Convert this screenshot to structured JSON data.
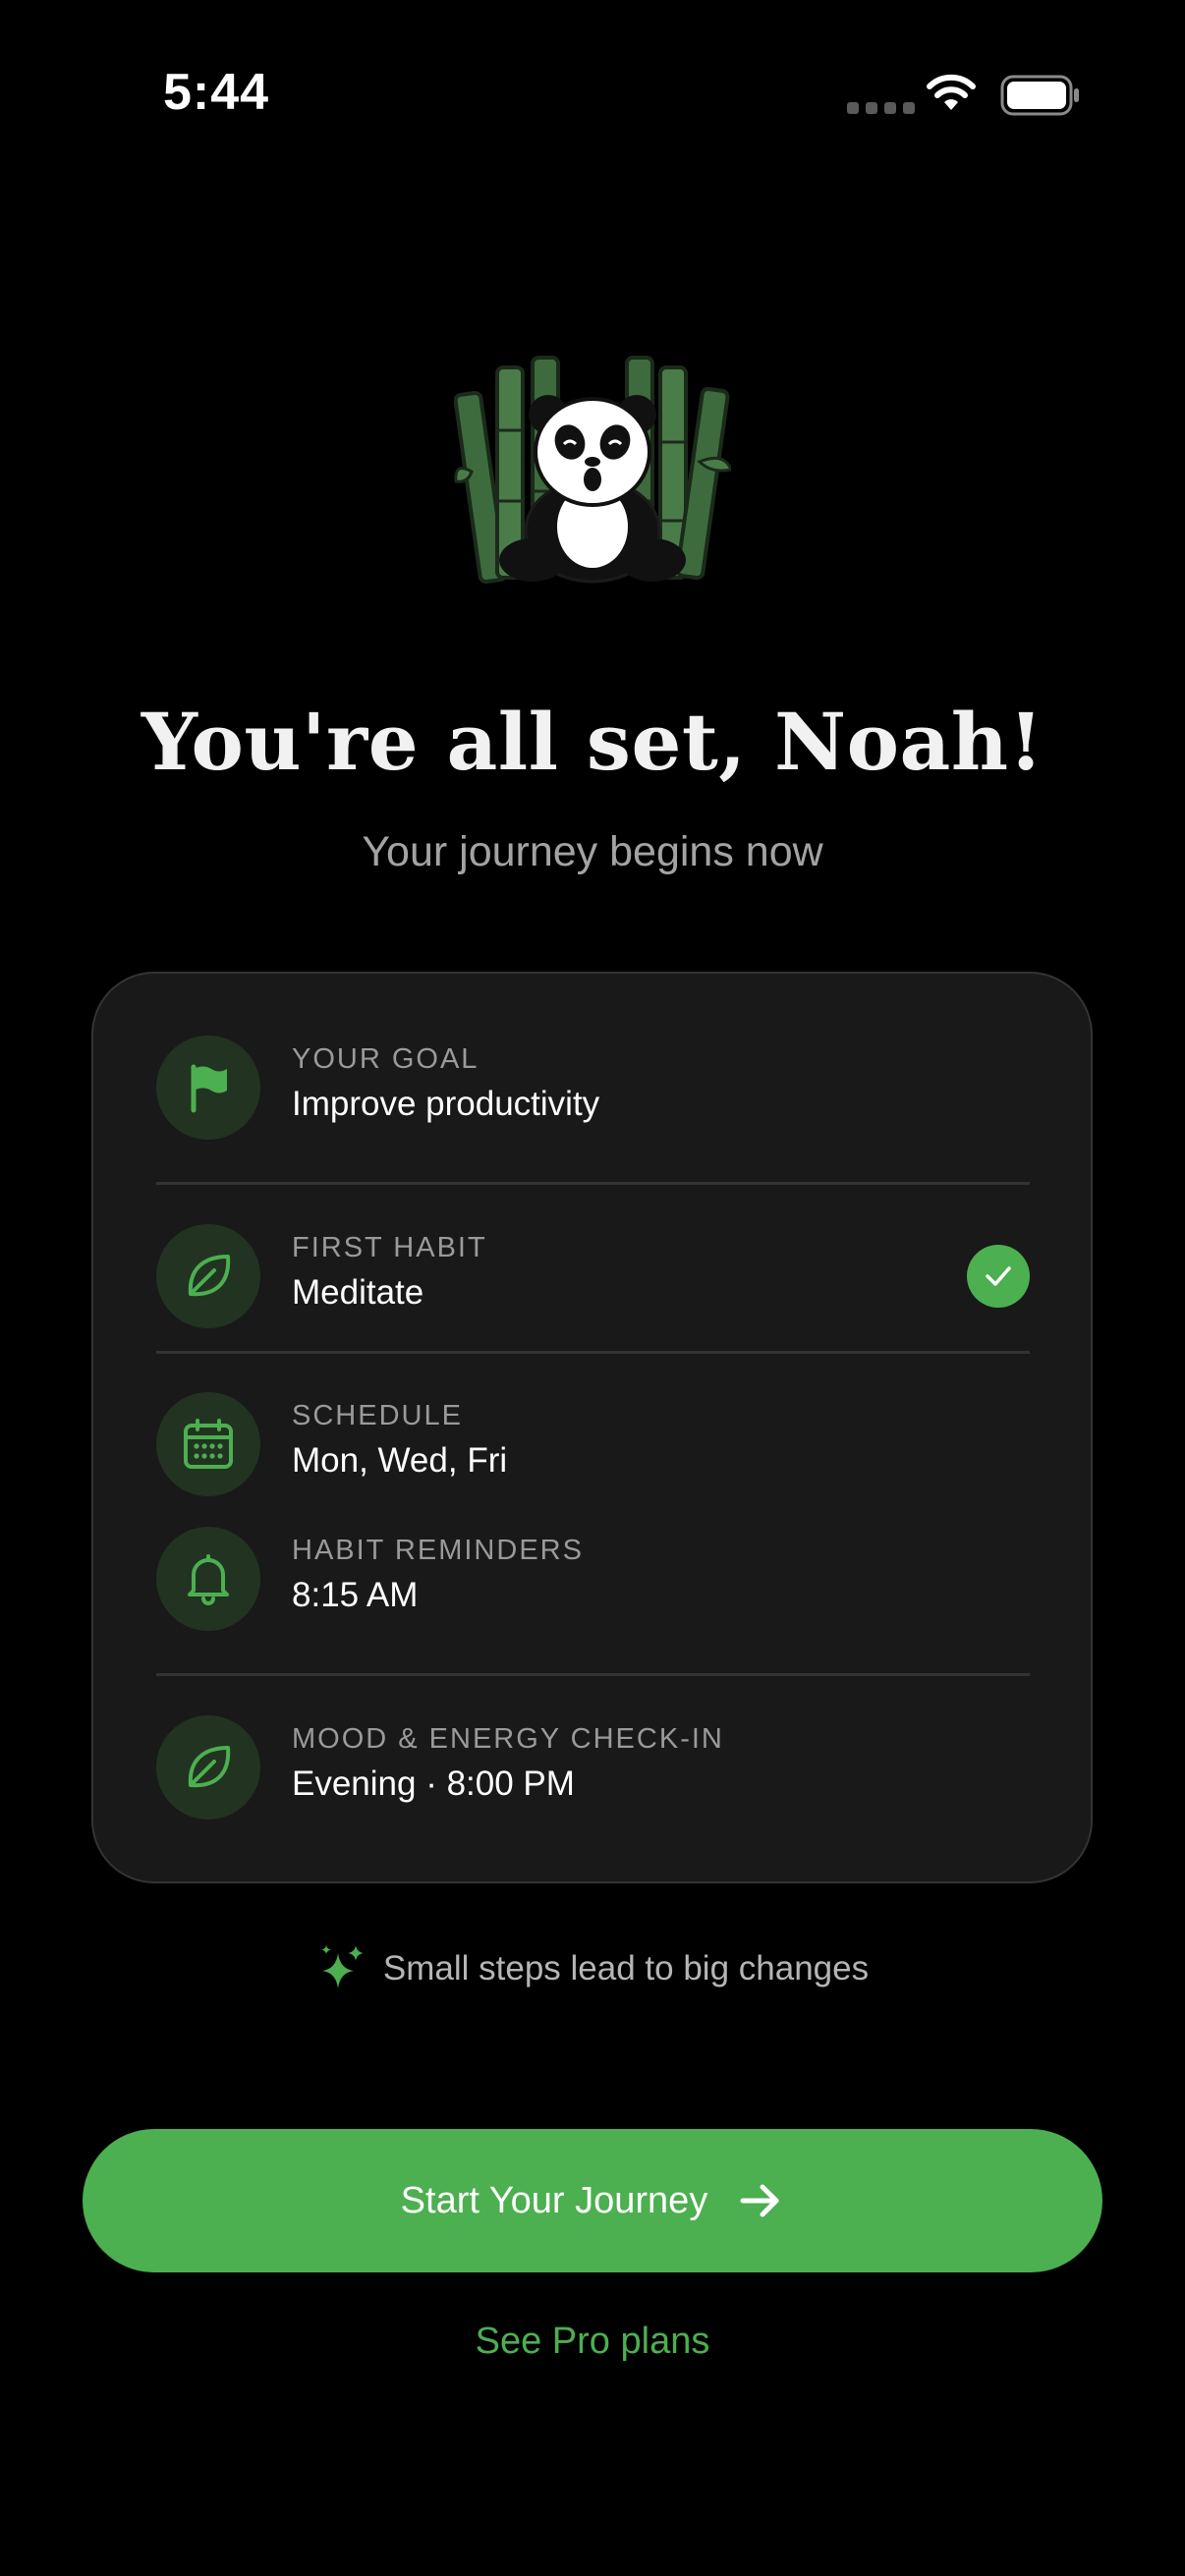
{
  "status_bar": {
    "time": "5:44",
    "icons": [
      "cellular-dots-icon",
      "wifi-icon",
      "battery-icon"
    ]
  },
  "mascot": {
    "icon": "panda-bamboo-illustration"
  },
  "header": {
    "title": "You're all set, Noah!",
    "subtitle": "Your journey begins now"
  },
  "summary": {
    "goal": {
      "icon": "flag-icon",
      "label": "YOUR GOAL",
      "value": "Improve productivity"
    },
    "first_habit": {
      "icon": "leaf-icon",
      "label": "FIRST HABIT",
      "value": "Meditate",
      "selected_icon": "check-icon"
    },
    "schedule": {
      "icon": "calendar-icon",
      "label": "SCHEDULE",
      "value": "Mon, Wed, Fri"
    },
    "reminders": {
      "icon": "bell-icon",
      "label": "HABIT REMINDERS",
      "value": "8:15 AM"
    },
    "checkin": {
      "icon": "leaf-icon",
      "label": "MOOD & ENERGY CHECK-IN",
      "value": "Evening · 8:00 PM"
    }
  },
  "tagline": {
    "icon": "sparkles-icon",
    "text": "Small steps lead to big changes"
  },
  "actions": {
    "primary_label": "Start Your Journey",
    "primary_icon": "arrow-right-icon",
    "secondary_label": "See Pro plans"
  },
  "colors": {
    "background": "#000000",
    "card": "#191919",
    "accent": "#4caf50",
    "icon_bg": "#223322",
    "muted_text": "#9a9a9a"
  }
}
